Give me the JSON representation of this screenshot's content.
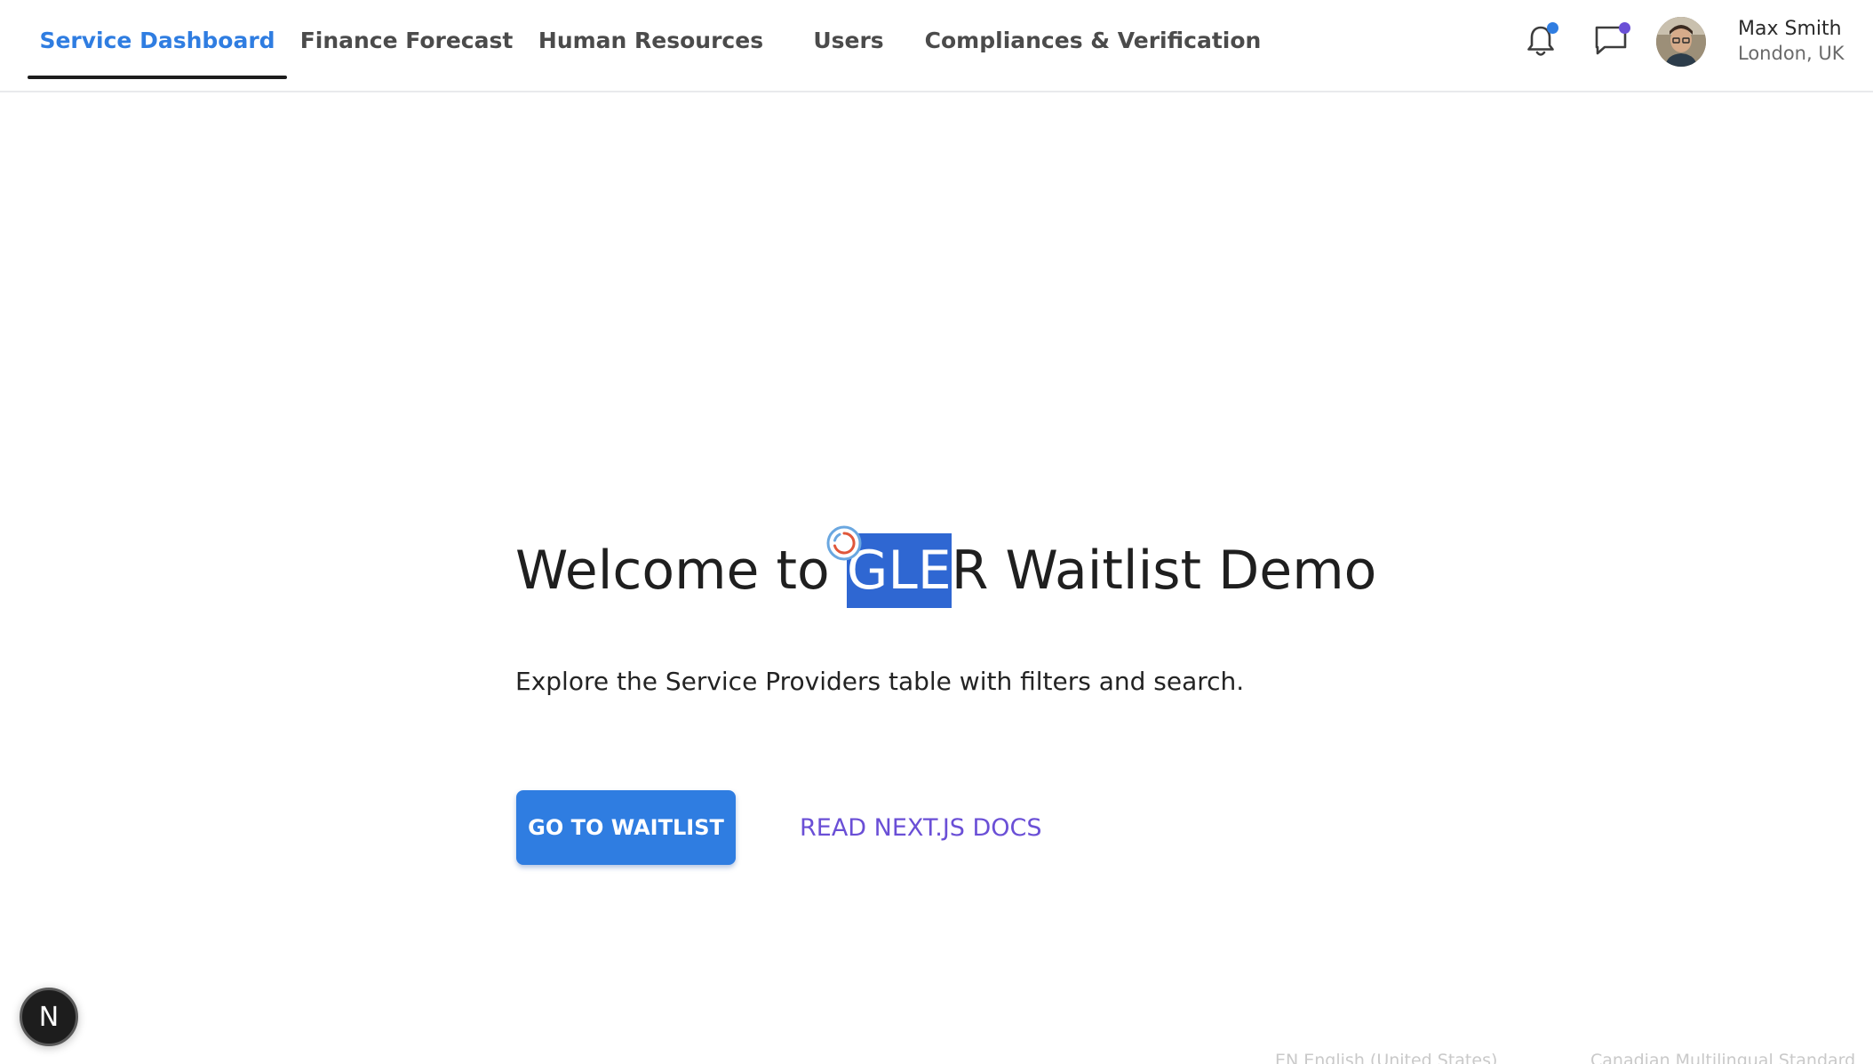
{
  "nav": {
    "tabs": [
      {
        "label": "Service Dashboard",
        "active": true
      },
      {
        "label": "Finance Forecast",
        "active": false
      },
      {
        "label": "Human Resources",
        "active": false
      },
      {
        "label": "Users",
        "active": false
      },
      {
        "label": "Compliances & Verification",
        "active": false
      }
    ]
  },
  "header": {
    "notifications_icon": "bell-icon",
    "messages_icon": "chat-bubble-icon",
    "user": {
      "name": "Max Smith",
      "location": "London, UK"
    }
  },
  "hero": {
    "title_before": "Welcome to ",
    "title_highlight": "GLE",
    "title_after": "R Waitlist Demo",
    "subtitle": "Explore the Service Providers table with filters and search.",
    "primary_button": "GO TO WAITLIST",
    "secondary_link": "READ NEXT.JS DOCS"
  },
  "badge": {
    "label": "N"
  },
  "taskbar": {
    "language": "EN English (United States)",
    "keyboard": "Canadian Multilingual Standard"
  },
  "colors": {
    "accent": "#2f7de1",
    "highlight": "#2f67d2",
    "link": "#6a4fd6",
    "notification_dot": "#2f7de1",
    "message_dot": "#6a4fd6"
  }
}
